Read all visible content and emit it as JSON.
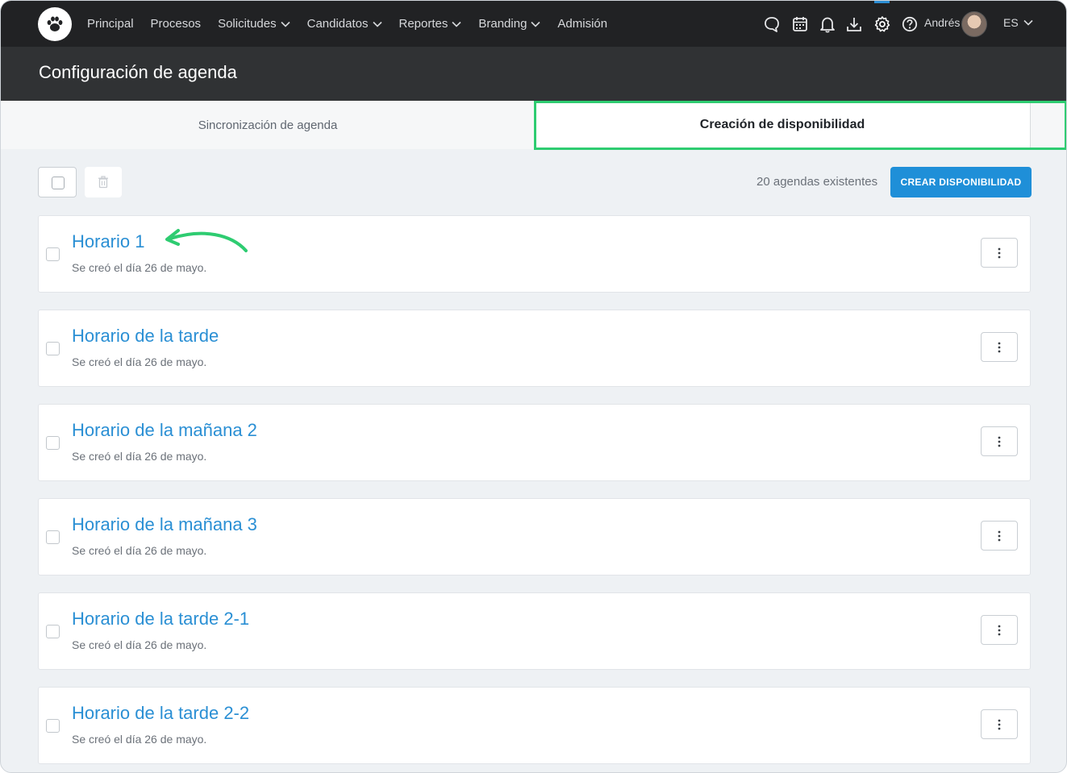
{
  "nav": {
    "items": [
      {
        "label": "Principal",
        "dropdown": false
      },
      {
        "label": "Procesos",
        "dropdown": false
      },
      {
        "label": "Solicitudes",
        "dropdown": true
      },
      {
        "label": "Candidatos",
        "dropdown": true
      },
      {
        "label": "Reportes",
        "dropdown": true
      },
      {
        "label": "Branding",
        "dropdown": true
      },
      {
        "label": "Admisión",
        "dropdown": false
      }
    ],
    "icons": [
      "chat-icon",
      "calendar-icon",
      "bell-icon",
      "download-icon",
      "gear-icon",
      "help-icon"
    ],
    "user_name": "Andrés",
    "language": "ES"
  },
  "header": {
    "title": "Configuración de agenda"
  },
  "tabs": [
    {
      "label": "Sincronización de agenda",
      "active": false
    },
    {
      "label": "Creación de disponibilidad",
      "active": true
    }
  ],
  "toolbar": {
    "count_text": "20 agendas existentes",
    "create_label": "CREAR DISPONIBILIDAD"
  },
  "schedules": [
    {
      "title": "Horario 1",
      "created": "Se creó el día 26 de mayo."
    },
    {
      "title": "Horario de la tarde",
      "created": "Se creó el día 26 de mayo."
    },
    {
      "title": "Horario de la mañana 2",
      "created": "Se creó el día 26 de mayo."
    },
    {
      "title": "Horario de la mañana 3",
      "created": "Se creó el día 26 de mayo."
    },
    {
      "title": "Horario de la tarde 2-1",
      "created": "Se creó el día 26 de mayo."
    },
    {
      "title": "Horario de la tarde 2-2",
      "created": "Se creó el día 26 de mayo."
    }
  ],
  "colors": {
    "accent": "#1f8fd8",
    "highlight": "#2ecc71",
    "nav_bg": "#212224",
    "header_bg": "#303234"
  }
}
